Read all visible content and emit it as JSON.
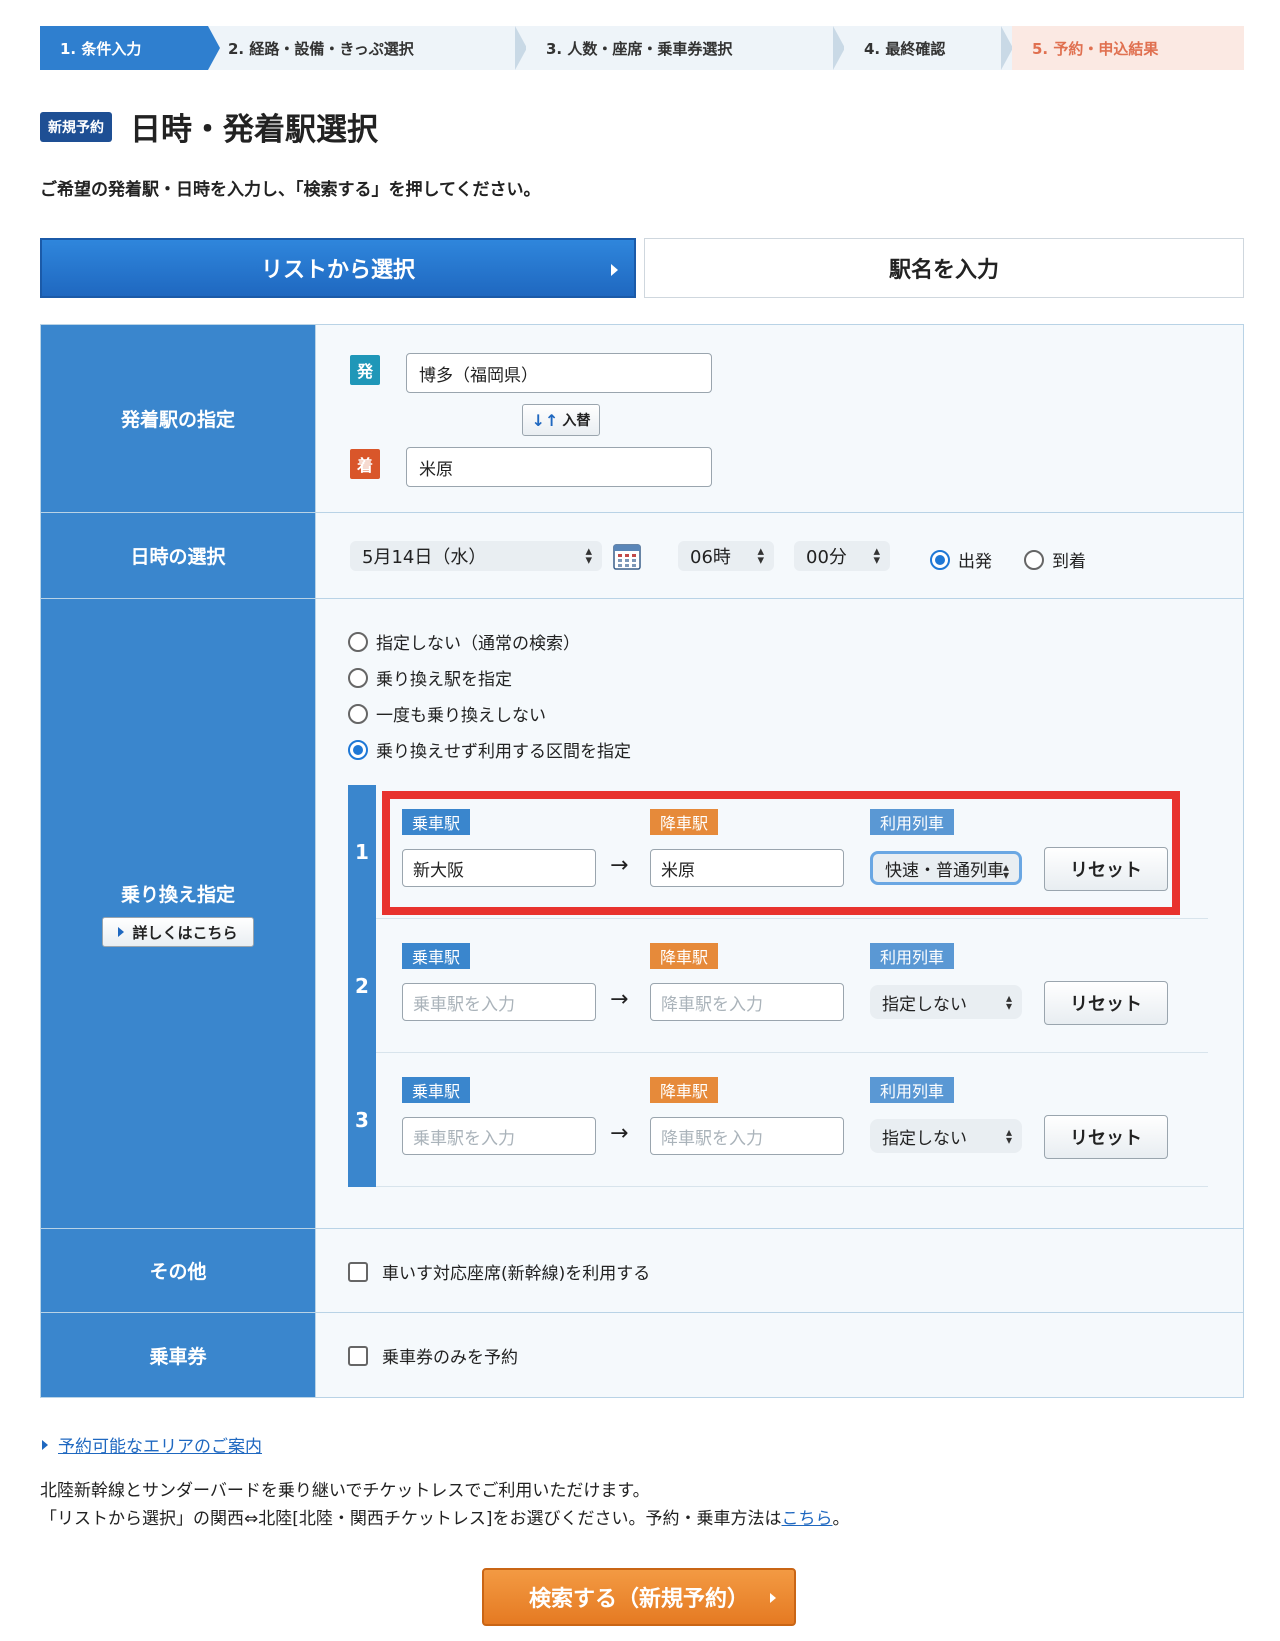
{
  "steps": [
    {
      "label": "1. 条件入力"
    },
    {
      "label": "2. 経路・設備・きっぷ選択"
    },
    {
      "label": "3. 人数・座席・乗車券選択"
    },
    {
      "label": "4. 最終確認"
    },
    {
      "label": "5. 予約・申込結果"
    }
  ],
  "header": {
    "badge": "新規予約",
    "title": "日時・発着駅選択",
    "instruction": "ご希望の発着駅・日時を入力し、「検索する」を押してください。"
  },
  "tabs": {
    "list": "リストから選択",
    "name": "駅名を入力"
  },
  "stations": {
    "label": "発着駅の指定",
    "dep_badge": "発",
    "arr_badge": "着",
    "departure": "博多（福岡県）",
    "arrival": "米原",
    "swap_label": "入替",
    "swap_arrows": "↓↑"
  },
  "datetime": {
    "label": "日時の選択",
    "date": "5月14日（水）",
    "hour": "06時",
    "minute": "00分",
    "depart_label": "出発",
    "arrive_label": "到着",
    "selected": "出発"
  },
  "transfer": {
    "label": "乗り換え指定",
    "detail_button": "詳しくはこちら",
    "options": [
      {
        "label": "指定しない（通常の検索）",
        "selected": false
      },
      {
        "label": "乗り換え駅を指定",
        "selected": false
      },
      {
        "label": "一度も乗り換えしない",
        "selected": false
      },
      {
        "label": "乗り換えせず利用する区間を指定",
        "selected": true
      }
    ],
    "board_tag": "乗車駅",
    "alight_tag": "降車駅",
    "train_tag": "利用列車",
    "reset_label": "リセット",
    "arrow": "→",
    "segments": [
      {
        "num": "1",
        "board": "新大阪",
        "alight": "米原",
        "train": "快速・普通列車",
        "highlighted": true
      },
      {
        "num": "2",
        "board": "乗車駅を入力",
        "alight": "降車駅を入力",
        "train": "指定しない",
        "placeholder": true
      },
      {
        "num": "3",
        "board": "乗車駅を入力",
        "alight": "降車駅を入力",
        "train": "指定しない",
        "placeholder": true
      }
    ]
  },
  "other": {
    "label": "その他",
    "wheelchair": "車いす対応座席(新幹線)を利用する"
  },
  "ticket": {
    "label": "乗車券",
    "ticket_only": "乗車券のみを予約"
  },
  "footer": {
    "area_link": "予約可能なエリアのご案内",
    "note1": "北陸新幹線とサンダーバードを乗り継いでチケットレスでご利用いただけます。",
    "note2_prefix": "「リストから選択」の関西⇔北陸[北陸・関西チケットレス]をお選びください。予約・乗車方法は",
    "note2_link": "こちら",
    "note2_suffix": "。",
    "search_button": "検索する（新規予約）"
  },
  "colors": {
    "primary": "#3a86cd",
    "accent": "#e57a22",
    "highlight": "#e8332e"
  },
  "icons": [
    "calendar-icon",
    "swap-icon",
    "chevron-updown-icon",
    "triangle-right-icon"
  ]
}
